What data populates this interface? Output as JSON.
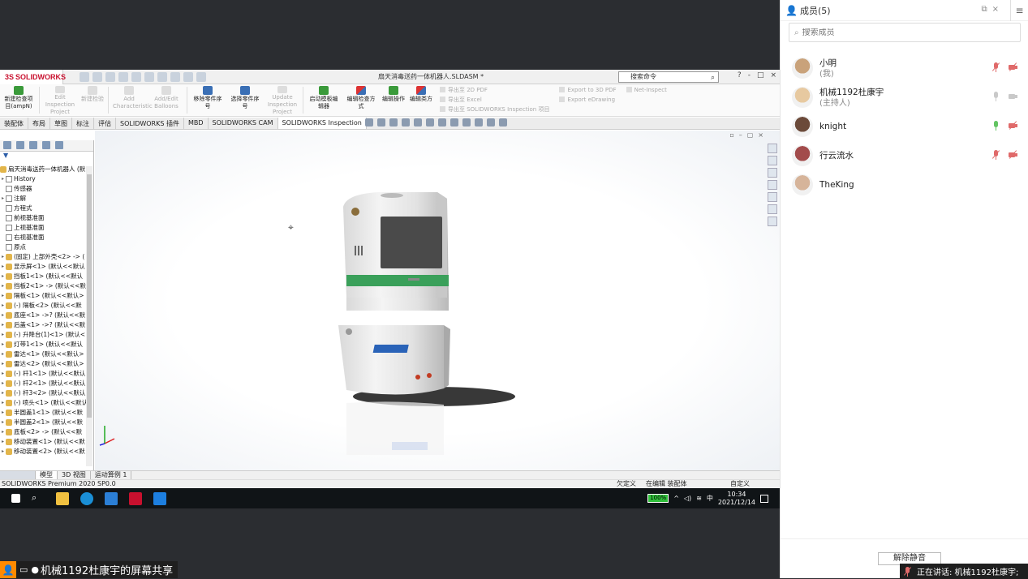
{
  "solidworks": {
    "logo_text": "SOLIDWORKS",
    "doc_title": "扇天消毒送药一体机器人.SLDASM *",
    "search_placeholder": "搜索命令",
    "window_controls": [
      "?",
      "-",
      "□",
      "×"
    ],
    "ribbon": [
      {
        "label": "新建检查项目(ampN)",
        "enabled": true,
        "color": "green"
      },
      {
        "label": "Edit Inspection Project",
        "enabled": false
      },
      {
        "label": "新建检验",
        "enabled": false
      },
      {
        "label": "Add Characteristic",
        "enabled": false
      },
      {
        "label": "Add/Edit Balloons",
        "enabled": false
      },
      {
        "label": "移除零件序号",
        "enabled": true,
        "color": "blue"
      },
      {
        "label": "选择零件序号",
        "enabled": true,
        "color": "blue"
      },
      {
        "label": "Update Inspection Project",
        "enabled": false
      },
      {
        "label": "启动模板编辑器",
        "enabled": true,
        "color": "green"
      },
      {
        "label": "编辑检查方式",
        "enabled": true,
        "color": "mix"
      },
      {
        "label": "编辑操作",
        "enabled": true,
        "color": "green"
      },
      {
        "label": "编辑类方",
        "enabled": true,
        "color": "mix"
      }
    ],
    "ribbon_exports_1": [
      "导出至 2D PDF",
      "导出至 Excel",
      "导出至 SOLIDWORKS Inspection 项目"
    ],
    "ribbon_exports_2": [
      "Export to 3D PDF",
      "Export eDrawing"
    ],
    "ribbon_net_inspect": "Net-Inspect",
    "tabs": [
      "装配体",
      "布局",
      "草图",
      "标注",
      "评估",
      "SOLIDWORKS 插件",
      "MBD",
      "SOLIDWORKS CAM",
      "SOLIDWORKS Inspection"
    ],
    "active_tab": "SOLIDWORKS Inspection",
    "tree": {
      "filter_icon": "funnel-icon",
      "root": "扇天消毒送药一体机器人 (默",
      "items": [
        {
          "label": "History",
          "icon": "doc",
          "arrow": "▸"
        },
        {
          "label": "传感器",
          "icon": "doc",
          "arrow": ""
        },
        {
          "label": "注解",
          "icon": "doc",
          "arrow": "▸"
        },
        {
          "label": "方程式",
          "icon": "doc",
          "arrow": ""
        },
        {
          "label": "前视基准面",
          "icon": "doc",
          "arrow": ""
        },
        {
          "label": "上视基准面",
          "icon": "doc",
          "arrow": ""
        },
        {
          "label": "右视基准面",
          "icon": "doc",
          "arrow": ""
        },
        {
          "label": "原点",
          "icon": "doc",
          "arrow": ""
        },
        {
          "label": "(固定) 上部外壳<2> -> (",
          "icon": "part",
          "arrow": "▸"
        },
        {
          "label": "显示屏<1> (默认<<默认",
          "icon": "part",
          "arrow": "▸"
        },
        {
          "label": "挡板1<1> (默认<<默认",
          "icon": "part",
          "arrow": "▸"
        },
        {
          "label": "挡板2<1> -> (默认<<默",
          "icon": "part",
          "arrow": "▸"
        },
        {
          "label": "隔板<1> (默认<<默认>",
          "icon": "part",
          "arrow": "▸"
        },
        {
          "label": "(-) 隔板<2> (默认<<默",
          "icon": "part",
          "arrow": "▸"
        },
        {
          "label": "底座<1> ->? (默认<<默",
          "icon": "part",
          "arrow": "▸"
        },
        {
          "label": "后盖<1> ->? (默认<<默",
          "icon": "part",
          "arrow": "▸"
        },
        {
          "label": "(-) 升降台(1)<1> (默认<",
          "icon": "part",
          "arrow": "▸"
        },
        {
          "label": "灯带1<1> (默认<<默认",
          "icon": "part",
          "arrow": "▸"
        },
        {
          "label": "雷达<1> (默认<<默认>",
          "icon": "part",
          "arrow": "▸"
        },
        {
          "label": "雷达<2> (默认<<默认>",
          "icon": "part",
          "arrow": "▸"
        },
        {
          "label": "(-) 杆1<1> (默认<<默认",
          "icon": "part",
          "arrow": "▸"
        },
        {
          "label": "(-) 杆2<1> (默认<<默认",
          "icon": "part",
          "arrow": "▸"
        },
        {
          "label": "(-) 杆3<2> (默认<<默认",
          "icon": "part",
          "arrow": "▸"
        },
        {
          "label": "(-) 喷头<1> (默认<<默认",
          "icon": "part",
          "arrow": "▸"
        },
        {
          "label": "半圆盖1<1> (默认<<默",
          "icon": "part",
          "arrow": "▸"
        },
        {
          "label": "半圆盖2<1> (默认<<默",
          "icon": "part",
          "arrow": "▸"
        },
        {
          "label": "底板<2> -> (默认<<默",
          "icon": "part",
          "arrow": "▸"
        },
        {
          "label": "移动装置<1> (默认<<默",
          "icon": "part",
          "arrow": "▸"
        },
        {
          "label": "移动装置<2> (默认<<默",
          "icon": "part",
          "arrow": "▸"
        }
      ]
    },
    "bottom_tabs": [
      "模型",
      "3D 视图",
      "运动算例 1"
    ],
    "active_bottom_tab": "模型",
    "status_left": "SOLIDWORKS Premium 2020 SP0.0",
    "status_right": [
      "欠定义",
      "在编辑 装配体"
    ],
    "status_custom": "自定义"
  },
  "taskbar": {
    "battery": "100%",
    "ime": "中",
    "time": "10:34",
    "date": "2021/12/14"
  },
  "share_label": "机械1192杜康宇的屏幕共享",
  "panel": {
    "title": "成员(5)",
    "search_placeholder": "搜索成员",
    "members": [
      {
        "name": "小明",
        "sub": "(我)",
        "avatar": "#c9a27a",
        "mic": "muted",
        "cam": "muted"
      },
      {
        "name": "机械1192杜康宇",
        "sub": "(主持人)",
        "avatar": "#e7c9a0",
        "mic": "grey",
        "cam": "grey"
      },
      {
        "name": "knight",
        "sub": "",
        "avatar": "#6b4a3a",
        "mic": "green",
        "cam": "muted"
      },
      {
        "name": "行云流水",
        "sub": "",
        "avatar": "#a24b4b",
        "mic": "muted",
        "cam": "muted"
      },
      {
        "name": "TheKing",
        "sub": "",
        "avatar": "#d6b49a",
        "mic": "",
        "cam": ""
      }
    ],
    "unmute_label": "解除静音",
    "speaking_label": "正在讲话: 机械1192杜康宇;"
  }
}
